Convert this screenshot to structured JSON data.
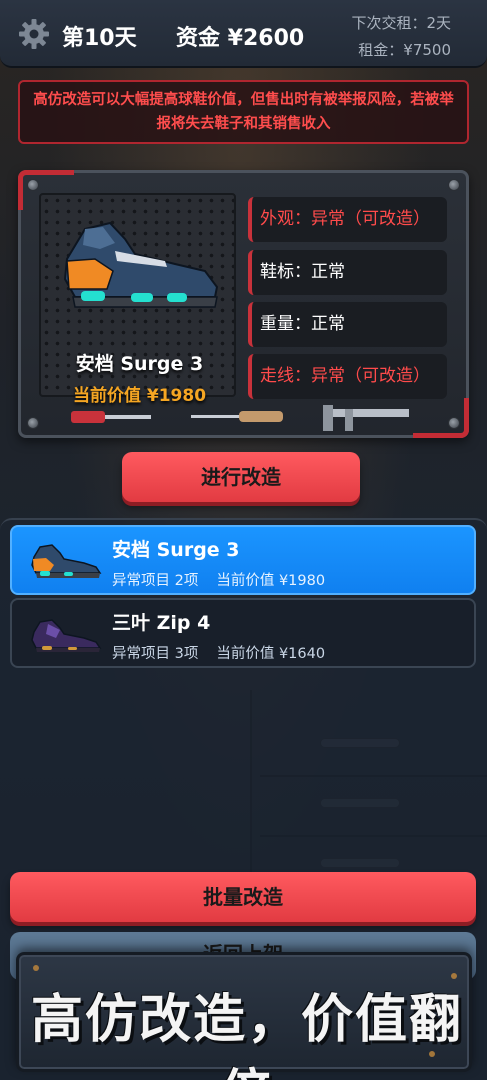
{
  "topbar": {
    "day": "第10天",
    "funds": "资金 ¥2600",
    "rent_due": "下次交租：2天",
    "rent_amount": "租金：¥7500"
  },
  "warning": "高仿改造可以大幅提高球鞋价值，但售出时有被举报风险，若被举报将失去鞋子和其销售收入",
  "current_shoe": {
    "name": "安档 Surge 3",
    "value": "当前价值 ¥1980",
    "attributes": [
      {
        "label": "外观：异常（可改造）",
        "status": "abnormal"
      },
      {
        "label": "鞋标：正常",
        "status": "normal"
      },
      {
        "label": "重量：正常",
        "status": "normal"
      },
      {
        "label": "走线：异常（可改造）",
        "status": "abnormal"
      }
    ]
  },
  "buttons": {
    "modify": "进行改造",
    "batch": "批量改造",
    "return": "返回上架"
  },
  "list": [
    {
      "name": "安档 Surge 3",
      "issues": "异常项目 2项",
      "value": "当前价值 ¥1980",
      "selected": true
    },
    {
      "name": "三叶 Zip 4",
      "issues": "异常项目 3项",
      "value": "当前价值 ¥1640",
      "selected": false
    }
  ],
  "promo": "高仿改造，价值翻倍",
  "colors": {
    "accent_red": "#e23b42",
    "selected_blue": "#1b95ff",
    "value_orange": "#f5a623",
    "warning_red": "#ff4d4d"
  },
  "icons": [
    "gear-icon",
    "shoe-icon",
    "screwdriver-icon",
    "awl-icon",
    "caliper-icon"
  ]
}
